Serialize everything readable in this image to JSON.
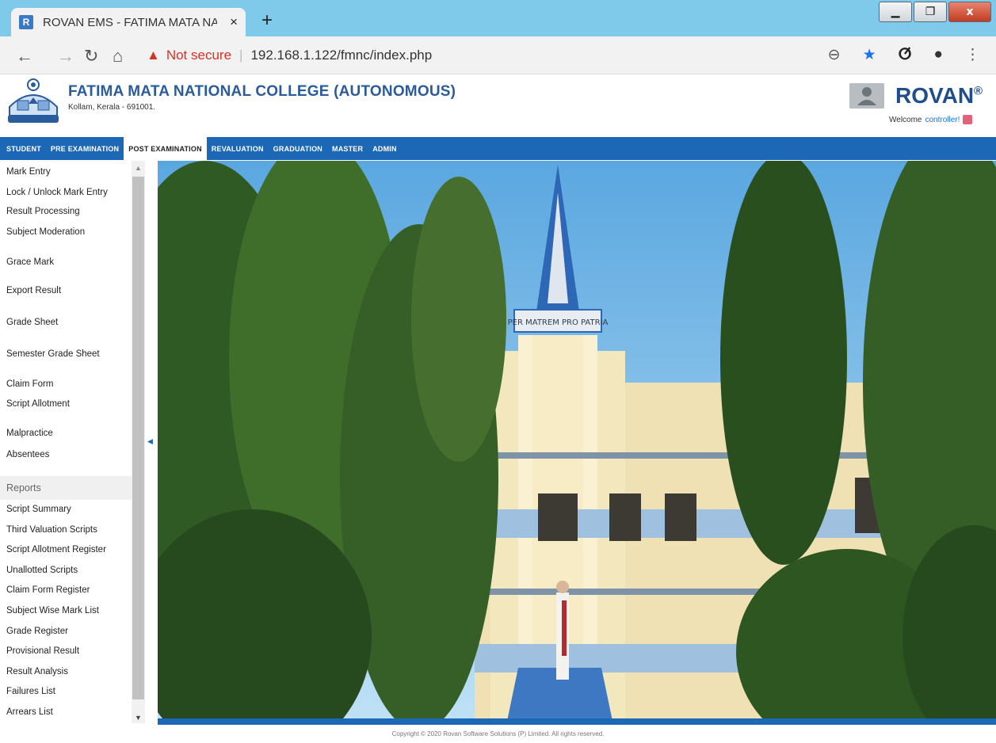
{
  "browser": {
    "tab_title": "ROVAN EMS - FATIMA MATA NA",
    "tab_favicon": "R",
    "tab_close": "×",
    "new_tab": "+",
    "security_label": "Not secure",
    "url": "192.168.1.122/fmnc/index.php",
    "win_min": "▁",
    "win_max": "❐",
    "win_close": "x"
  },
  "header": {
    "college_name": "FATIMA MATA NATIONAL COLLEGE (AUTONOMOUS)",
    "college_address": "Kollam, Kerala - 691001.",
    "brand": "ROVAN",
    "brand_mark": "®",
    "welcome_text": "Welcome",
    "username": "controller!"
  },
  "menu": {
    "items": [
      "STUDENT",
      "PRE EXAMINATION",
      "POST EXAMINATION",
      "REVALUATION",
      "GRADUATION",
      "MASTER",
      "ADMIN"
    ],
    "active": "POST EXAMINATION"
  },
  "sidebar": {
    "items": [
      "Mark Entry",
      "Lock / Unlock Mark Entry",
      "Result Processing",
      "Subject Moderation",
      "Grace Mark",
      "Export Result",
      "Grade Sheet",
      "Semester Grade Sheet",
      "Claim Form",
      "Script Allotment",
      "Malpractice",
      "Absentees"
    ],
    "reports_header": "Reports",
    "reports": [
      "Script Summary",
      "Third Valuation Scripts",
      "Script Allotment Register",
      "Unallotted Scripts",
      "Claim Form Register",
      "Subject Wise Mark List",
      "Grade Register",
      "Provisional Result",
      "Result Analysis",
      "Failures List",
      "Arrears List"
    ]
  },
  "photo": {
    "sign_text": "PER MATREM PRO PATRIA"
  },
  "footer": {
    "copyright": "Copyright © 2020 Rovan Software Solutions (P) Limited. All rights reserved."
  },
  "colors": {
    "menu_bar": "#1c68b7",
    "brand": "#1f4e8c",
    "tab_strip": "#7fcaea"
  }
}
